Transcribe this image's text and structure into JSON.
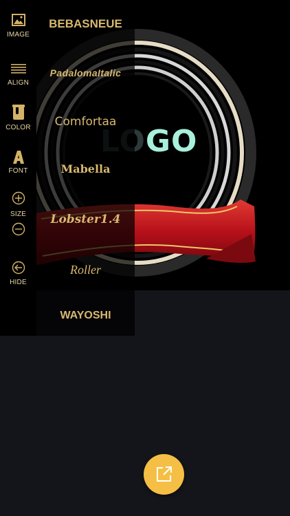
{
  "canvas": {
    "logo_part1": "LO",
    "logo_part2": "GO"
  },
  "toolbar": {
    "image_label": "IMAGE",
    "align_label": "ALIGN",
    "color_label": "COLOR",
    "font_label": "FONT",
    "size_label": "SIZE",
    "hide_label": "HIDE"
  },
  "fonts": [
    "BEBASNEUE",
    "PadalomaItalic",
    "Comfortaa",
    "Mabella",
    "Lobster1.4",
    "Roller",
    "WAYOSHI"
  ],
  "colors": {
    "accent": "#d8b870",
    "fab": "#f5bf45",
    "background": "#14151a",
    "ribbon": "#c0141a"
  }
}
